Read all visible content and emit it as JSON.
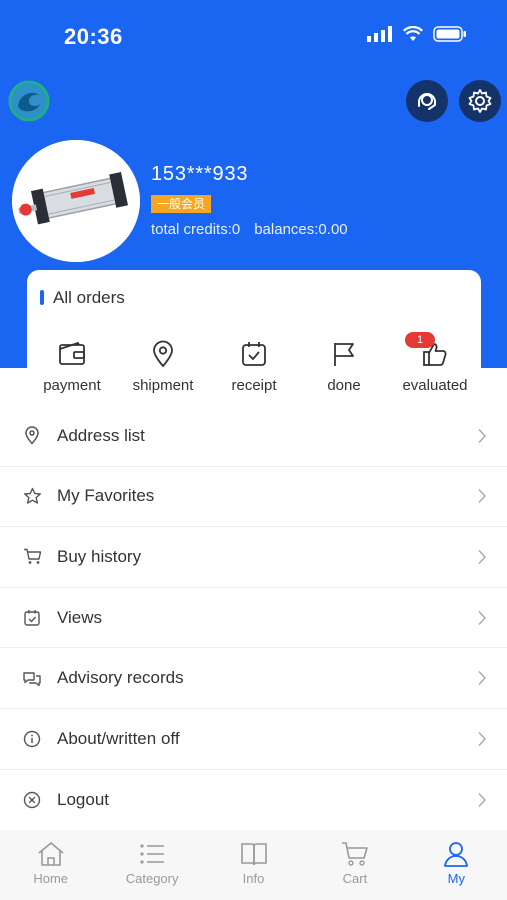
{
  "status": {
    "time": "20:36"
  },
  "user": {
    "name": "153***933",
    "member_level": "一般会员",
    "credits": "total credits:0",
    "balances": "balances:0.00"
  },
  "orders": {
    "title": "All orders",
    "items": [
      {
        "label": "payment",
        "icon": "wallet-icon"
      },
      {
        "label": "shipment",
        "icon": "location-pin-icon"
      },
      {
        "label": "receipt",
        "icon": "calendar-check-icon"
      },
      {
        "label": "done",
        "icon": "flag-icon"
      },
      {
        "label": "evaluated",
        "icon": "thumbs-up-icon",
        "badge": "1"
      }
    ]
  },
  "menu": [
    {
      "label": "Address list",
      "icon": "location-pin-icon"
    },
    {
      "label": "My Favorites",
      "icon": "star-icon"
    },
    {
      "label": "Buy history",
      "icon": "cart-icon"
    },
    {
      "label": "Views",
      "icon": "calendar-check-icon"
    },
    {
      "label": "Advisory records",
      "icon": "chat-icon"
    },
    {
      "label": "About/written off",
      "icon": "info-icon"
    },
    {
      "label": "Logout",
      "icon": "close-circle-icon"
    }
  ],
  "tabs": [
    {
      "label": "Home",
      "icon": "home-icon"
    },
    {
      "label": "Category",
      "icon": "list-icon"
    },
    {
      "label": "Info",
      "icon": "book-icon"
    },
    {
      "label": "Cart",
      "icon": "cart-icon"
    },
    {
      "label": "My",
      "icon": "user-icon",
      "active": true
    }
  ],
  "colors": {
    "primary": "#1a66f2",
    "badge": "#f5a623",
    "alert": "#e53935",
    "button_dark": "#14336b"
  }
}
